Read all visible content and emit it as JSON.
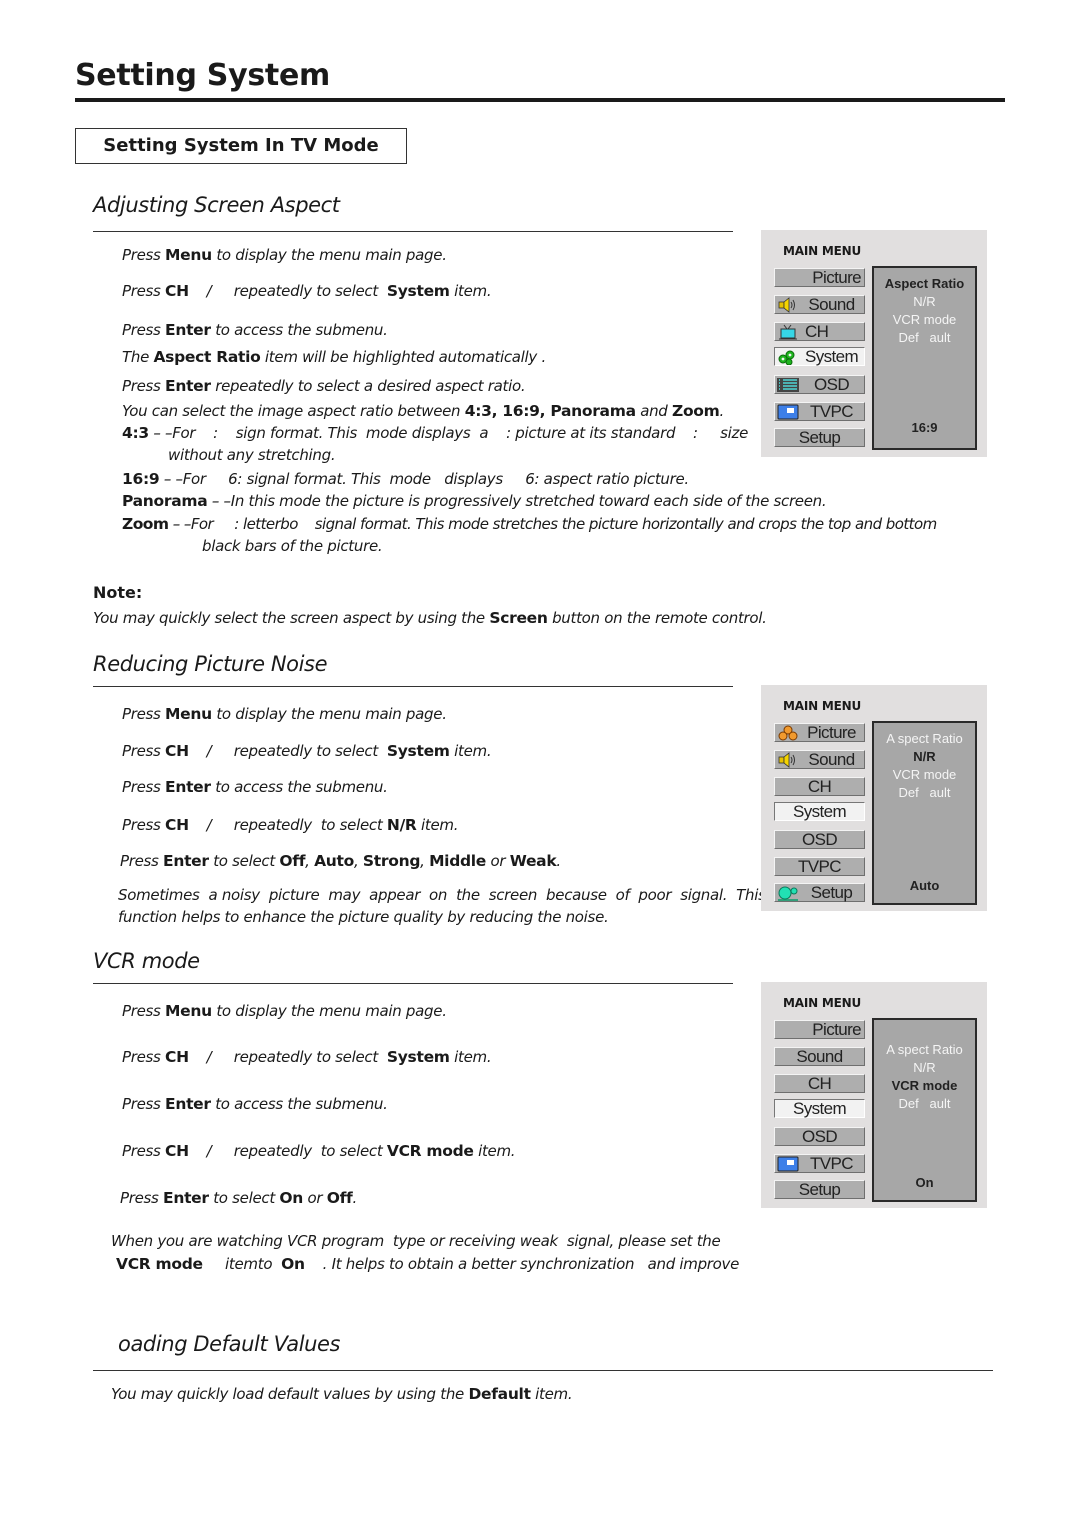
{
  "page": {
    "title": "Setting System",
    "section_box": "Setting System In TV Mode"
  },
  "aspect": {
    "heading": "Adjusting Screen Aspect",
    "steps": [
      {
        "a": "Press ",
        "b": "Menu",
        "c": " to display the menu main page."
      },
      {
        "a": "Press ",
        "b": "CH",
        "c": "    /     repeatedly to select  ",
        "b2": "System",
        "c2": " item."
      },
      {
        "a": "Press ",
        "b": "Enter",
        "c": " to access the submenu."
      },
      {
        "a": "The ",
        "b": "Aspect Ratio",
        "c": " item will be highlighted automatically ."
      },
      {
        "a": "Press ",
        "b": "Enter",
        "c": " repeatedly to select a desired aspect ratio."
      },
      {
        "a": "You can select the image aspect ratio between ",
        "b": "4:3, 16:9, Panorama",
        "c": " and ",
        "b2": "Zoom",
        "c2": "."
      }
    ],
    "modes": [
      {
        "name": "4:3",
        "desc": " – –For    :    sign format. This  mode displays  a    : picture at its standard    :     size",
        "desc2": "without any stretching."
      },
      {
        "name": "16:9",
        "desc": " – –For     6: signal format. This  mode   displays     6: aspect ratio picture."
      },
      {
        "name": "Panorama",
        "desc": " – –In this mode the picture is progressively  stretched toward each side of the screen."
      },
      {
        "name": "Zoom",
        "desc": " – –For     : letterbo    signal format. This mode stretches the picture horizontally and crops the top and bottom",
        "desc2": "black bars of the picture."
      }
    ],
    "note_label": "Note:",
    "note": {
      "a": "You may quickly select the screen aspect by using the ",
      "b": "Screen",
      "c": " button on the remote control."
    }
  },
  "noise": {
    "heading": "Reducing Picture Noise",
    "steps": [
      {
        "a": "Press ",
        "b": "Menu",
        "c": " to display the menu main page."
      },
      {
        "a": "Press ",
        "b": "CH",
        "c": "    /     repeatedly to select  ",
        "b2": "System",
        "c2": " item."
      },
      {
        "a": "Press ",
        "b": "Enter",
        "c": " to access the submenu."
      },
      {
        "a": "Press ",
        "b": "CH",
        "c": "    /     repeatedly  to select ",
        "b2": "N/R",
        "c2": " item."
      },
      {
        "a": "Press ",
        "b": "Enter",
        "c": " to select  ",
        "b2": "Off",
        "c2": ", ",
        "b3": "Auto",
        "c3": ", ",
        "b4": "Strong",
        "c4": ", ",
        "b5": "Middle",
        "c5": " or ",
        "b6": "Weak",
        "c6": "."
      }
    ],
    "desc": [
      "Sometimes  a noisy  picture  may  appear  on  the  screen  because  of  poor  signal.  This",
      "function helps to enhance the picture quality by reducing the noise."
    ]
  },
  "vcr": {
    "heading": "VCR mode",
    "steps": [
      {
        "a": "Press ",
        "b": "Menu",
        "c": " to display the menu main page."
      },
      {
        "a": "Press ",
        "b": "CH",
        "c": "    /     repeatedly to select  ",
        "b2": "System",
        "c2": " item."
      },
      {
        "a": "Press ",
        "b": "Enter",
        "c": " to access the submenu."
      },
      {
        "a": "Press ",
        "b": "CH",
        "c": "    /     repeatedly  to select ",
        "b2": "VCR mode",
        "c2": " item."
      },
      {
        "a": "Press ",
        "b": "Enter",
        "c": " to select ",
        "b2": "On",
        "c2": " or ",
        "b3": "Off",
        "c3": "."
      }
    ],
    "desc1": "When you are watching VCR program  type or receiving weak  signal, please set the",
    "desc2": {
      "b": "VCR mode",
      "a": "     itemto  ",
      "b2": "On",
      "c": "    . It helps to obtain a better synchronization   and improve"
    }
  },
  "defaults": {
    "heading": "oading Default Values",
    "text": {
      "a": "You may quickly load default values  by using the ",
      "b": "Default",
      "c": " item."
    }
  },
  "osd_menus": [
    {
      "title": "MAIN MENU",
      "items": [
        "Picture",
        "Sound",
        "CH",
        "System",
        "OSD",
        "TVPC",
        "Setup"
      ],
      "selected": "System",
      "submenu": [
        "Aspect Ratio",
        "N/R",
        "VCR mode",
        "Def   ault"
      ],
      "highlighted": "Aspect Ratio",
      "value": "16:9"
    },
    {
      "title": "MAIN MENU",
      "items": [
        "Picture",
        "Sound",
        "CH",
        "System",
        "OSD",
        "TVPC",
        "Setup"
      ],
      "selected": "System",
      "submenu": [
        "A spect Ratio",
        "N/R",
        "VCR mode",
        "Def   ault"
      ],
      "highlighted": "N/R",
      "value": "Auto"
    },
    {
      "title": "MAIN MENU",
      "items": [
        "Picture",
        "Sound",
        "CH",
        "System",
        "OSD",
        "TVPC",
        "Setup"
      ],
      "selected": "System",
      "submenu": [
        "A spect Ratio",
        "N/R",
        "VCR mode",
        "Def   ault"
      ],
      "highlighted": "VCR mode",
      "value": "On"
    }
  ],
  "icons": {
    "picture": "picture-icon (three-circle cluster)",
    "sound": "speaker-icon",
    "ch": "tv-icon",
    "system": "gears-icon",
    "osd": "list-icon",
    "tvpc": "monitor-icon",
    "setup": "setup-icon"
  }
}
